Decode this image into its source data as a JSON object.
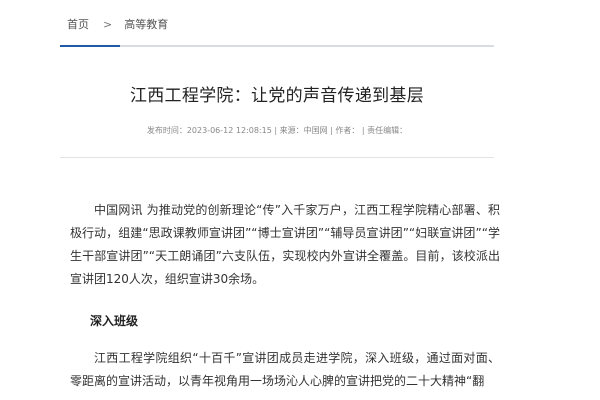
{
  "breadcrumb": {
    "home": "首页",
    "separator": ">",
    "current": "高等教育"
  },
  "article": {
    "title": "江西工程学院：让党的声音传递到基层",
    "meta": "发布时间：2023-06-12 12:08:15 | 来源：中国网 | 作者： | 责任编辑：",
    "paragraphs": [
      "中国网讯 为推动党的创新理论“传”入千家万户，江西工程学院精心部署、积极行动，组建“思政课教师宣讲团”“博士宣讲团”“辅导员宣讲团”“妇联宣讲团”“学生干部宣讲团”“天工朗诵团”六支队伍，实现校内外宣讲全覆盖。目前，该校派出宣讲团120人次，组织宣讲30余场。",
      "江西工程学院组织“十百千”宣讲团成员走进学院，深入班级，通过面对面、零距离的宣讲活动，以青年视角用一场场沁人心脾的宣讲把党的二十大精神“翻"
    ],
    "subheading": "深入班级"
  },
  "colors": {
    "accent": "#1f5aa8",
    "rule": "#d9dde3",
    "text": "#333333",
    "muted": "#888888"
  }
}
